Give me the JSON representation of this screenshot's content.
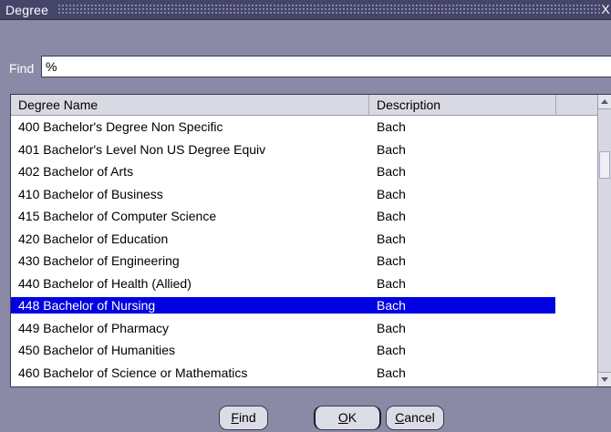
{
  "window": {
    "title": "Degree",
    "close_glyph": "X"
  },
  "find": {
    "label": "Find",
    "value": "%"
  },
  "grid": {
    "columns": [
      "Degree Name",
      "Description",
      ""
    ],
    "rows": [
      {
        "name": "400 Bachelor's Degree Non Specific",
        "desc": "Bach"
      },
      {
        "name": "401 Bachelor's Level Non US Degree Equiv",
        "desc": "Bach"
      },
      {
        "name": "402 Bachelor of Arts",
        "desc": "Bach"
      },
      {
        "name": "410 Bachelor of Business",
        "desc": "Bach"
      },
      {
        "name": "415 Bachelor of Computer Science",
        "desc": "Bach"
      },
      {
        "name": "420 Bachelor of Education",
        "desc": "Bach"
      },
      {
        "name": "430 Bachelor of Engineering",
        "desc": "Bach"
      },
      {
        "name": "440 Bachelor of Health (Allied)",
        "desc": "Bach"
      },
      {
        "name": "448 Bachelor of Nursing",
        "desc": "Bach",
        "selected": true
      },
      {
        "name": "449 Bachelor of Pharmacy",
        "desc": "Bach"
      },
      {
        "name": "450 Bachelor of Humanities",
        "desc": "Bach"
      },
      {
        "name": "460 Bachelor of Science or Mathematics",
        "desc": "Bach"
      }
    ],
    "selection_color": "#0000e0"
  },
  "buttons": {
    "find": {
      "mnemonic": "F",
      "rest": "ind"
    },
    "ok": {
      "mnemonic": "O",
      "rest": "K"
    },
    "cancel": {
      "mnemonic": "C",
      "rest": "ancel"
    }
  },
  "colors": {
    "dialog_bg": "#8a8aa6",
    "titlebar_bg": "#45456a",
    "button_bg": "#dcdce6"
  }
}
